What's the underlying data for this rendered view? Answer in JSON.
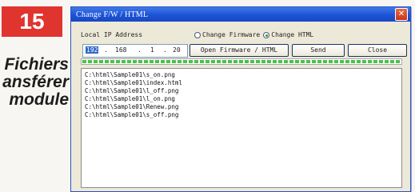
{
  "page": {
    "badge_number": "15",
    "side_text": [
      "Fichiers",
      "ansférer",
      "module"
    ]
  },
  "window": {
    "title": "Change F/W / HTML",
    "close_glyph": "✕"
  },
  "form": {
    "local_ip_label": "Local IP Address",
    "radio_firmware_label": "Change Firmware",
    "radio_html_label": "Change HTML",
    "selected_mode": "Change HTML",
    "ip": [
      "192",
      "168",
      "1",
      "20"
    ],
    "ip_separator": ".",
    "open_button": "Open Firmware / HTML",
    "send_button": "Send",
    "close_button": "Close",
    "progress_fraction": 1.0
  },
  "files": [
    "C:\\html\\Sample01\\s_on.png",
    "C:\\html\\Sample01\\index.html",
    "C:\\html\\Sample01\\l_off.png",
    "C:\\html\\Sample01\\l_on.png",
    "C:\\html\\Sample01\\Renew.png",
    "C:\\html\\Sample01\\s_off.png"
  ],
  "colors": {
    "badge": "#e0342f",
    "titlebar": "#1d53d6",
    "progress": "#4cc04c"
  }
}
